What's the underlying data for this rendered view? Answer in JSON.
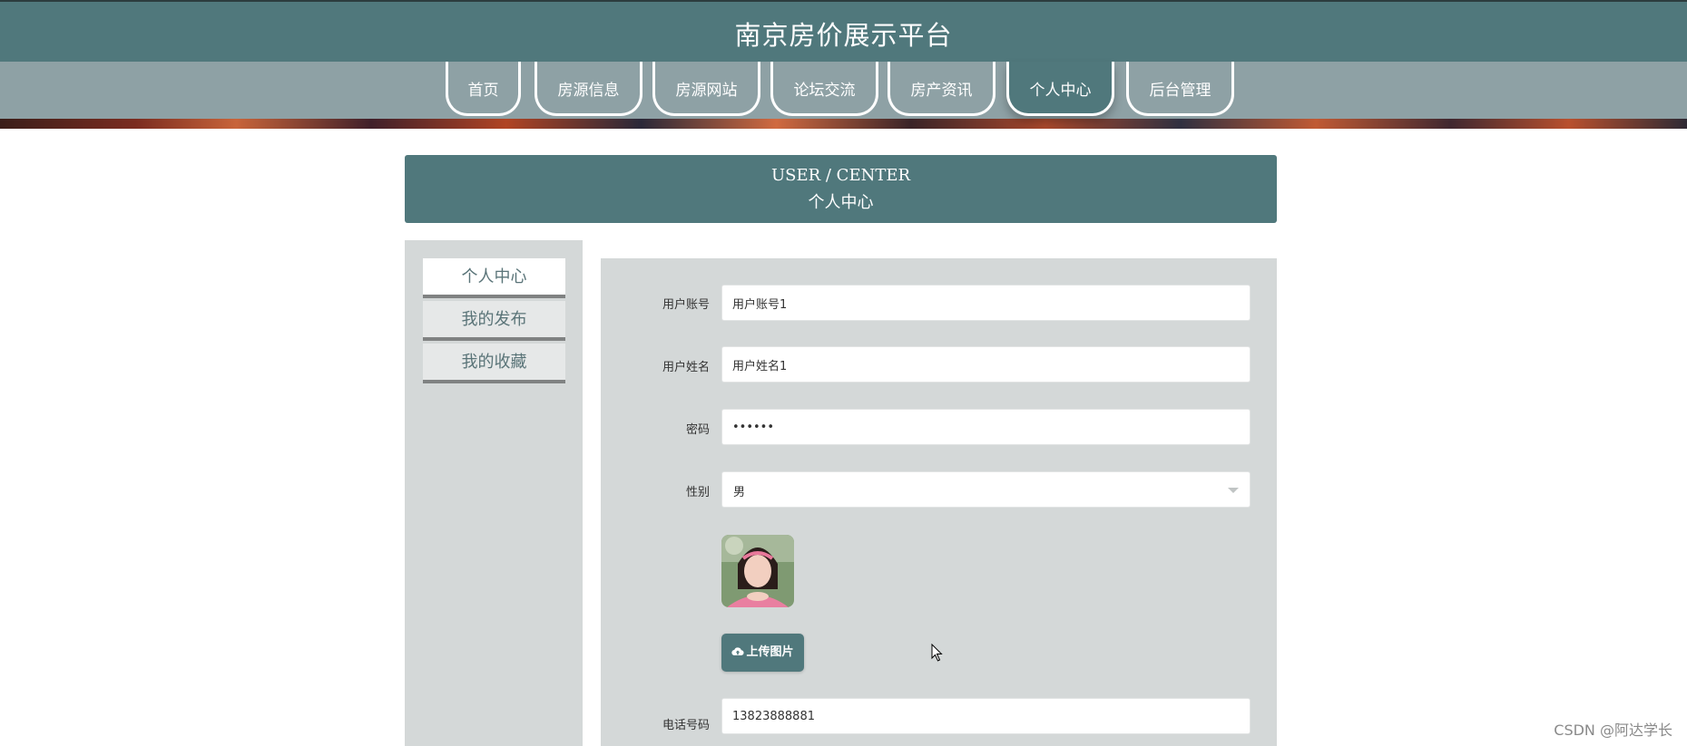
{
  "site": {
    "title": "南京房价展示平台"
  },
  "nav": {
    "items": [
      {
        "label": "首页"
      },
      {
        "label": "房源信息"
      },
      {
        "label": "房源网站"
      },
      {
        "label": "论坛交流"
      },
      {
        "label": "房产资讯"
      },
      {
        "label": "个人中心",
        "active": true
      },
      {
        "label": "后台管理"
      }
    ]
  },
  "section": {
    "title_en": "USER / CENTER",
    "title_cn": "个人中心"
  },
  "sidebar": {
    "items": [
      {
        "label": "个人中心",
        "active": true
      },
      {
        "label": "我的发布"
      },
      {
        "label": "我的收藏"
      }
    ]
  },
  "form": {
    "username": {
      "label": "用户账号",
      "value": "用户账号1"
    },
    "fullname": {
      "label": "用户姓名",
      "value": "用户姓名1"
    },
    "password": {
      "label": "密码",
      "value": "123456"
    },
    "gender": {
      "label": "性别",
      "value": "男"
    },
    "upload_label": "上传图片",
    "phone": {
      "label": "电话号码",
      "value": "13823888881"
    }
  },
  "watermark": "CSDN @阿达学长",
  "colors": {
    "primary": "#50787c",
    "nav_band": "#8ea1a5",
    "panel": "#d4d8d8"
  },
  "icons": {
    "upload": "cloud-upload-icon",
    "select": "chevron-down-icon",
    "cursor": "mouse-pointer-icon"
  }
}
